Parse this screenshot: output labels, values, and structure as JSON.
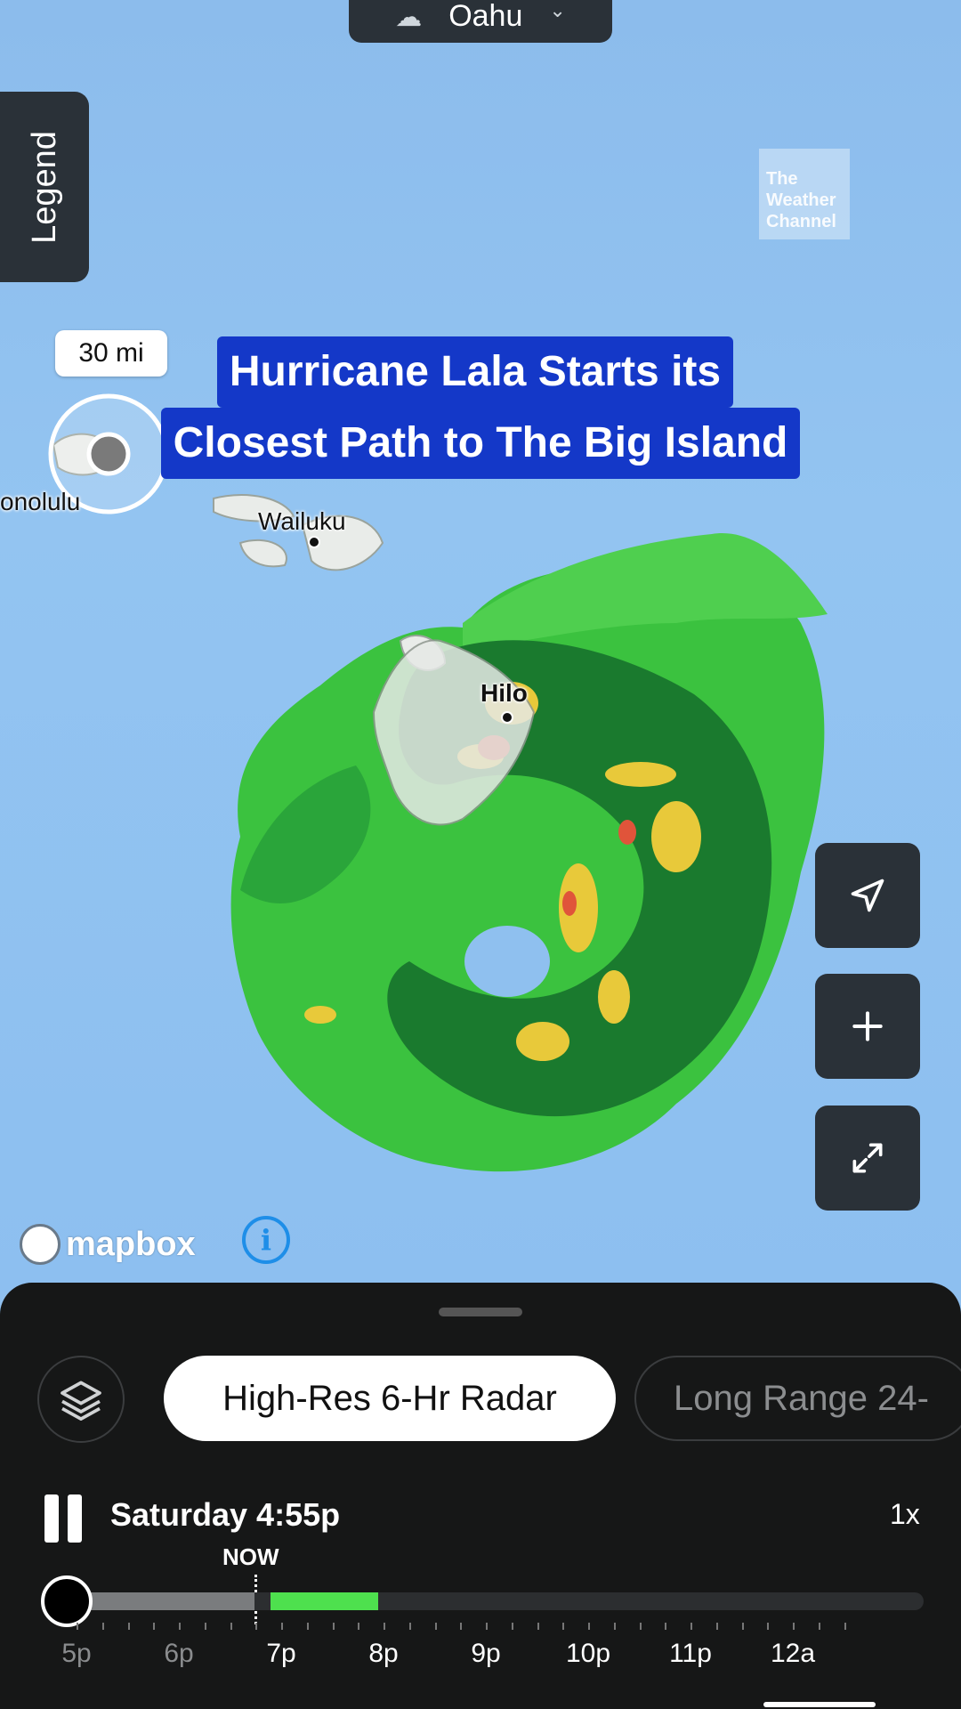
{
  "location_selector": {
    "name": "Oahu",
    "icon": "rain-cloud-icon",
    "chevron": "chevron-down-icon"
  },
  "legend_tab": {
    "label": "Legend"
  },
  "watermark": {
    "line1": "The",
    "line2": "Weather",
    "line3": "Channel"
  },
  "scale": {
    "label": "30 mi"
  },
  "headline": {
    "line1": "Hurricane Lala Starts its",
    "line2": "Closest Path to The Big Island",
    "background_color": "#1438c8"
  },
  "map_labels": {
    "honolulu": "onolulu",
    "wailuku": "Wailuku",
    "hilo": "Hilo"
  },
  "map_controls": {
    "locate_icon": "navigation-arrow-icon",
    "zoom_in_icon": "plus-icon",
    "fullscreen_icon": "expand-arrows-icon"
  },
  "attribution": {
    "brand": "mapbox",
    "info_glyph": "i"
  },
  "bottom_sheet": {
    "layers_icon": "layers-icon",
    "chips": [
      {
        "label": "High-Res 6-Hr Radar",
        "selected": true
      },
      {
        "label": "Long Range 24-",
        "selected": false
      }
    ],
    "playback": {
      "state": "playing",
      "current_time": "Saturday 4:55p",
      "speed": "1x",
      "now_label": "NOW",
      "green_accent": "#4ee04e",
      "hours": [
        "5p",
        "6p",
        "7p",
        "8p",
        "9p",
        "10p",
        "11p",
        "12a"
      ]
    }
  }
}
